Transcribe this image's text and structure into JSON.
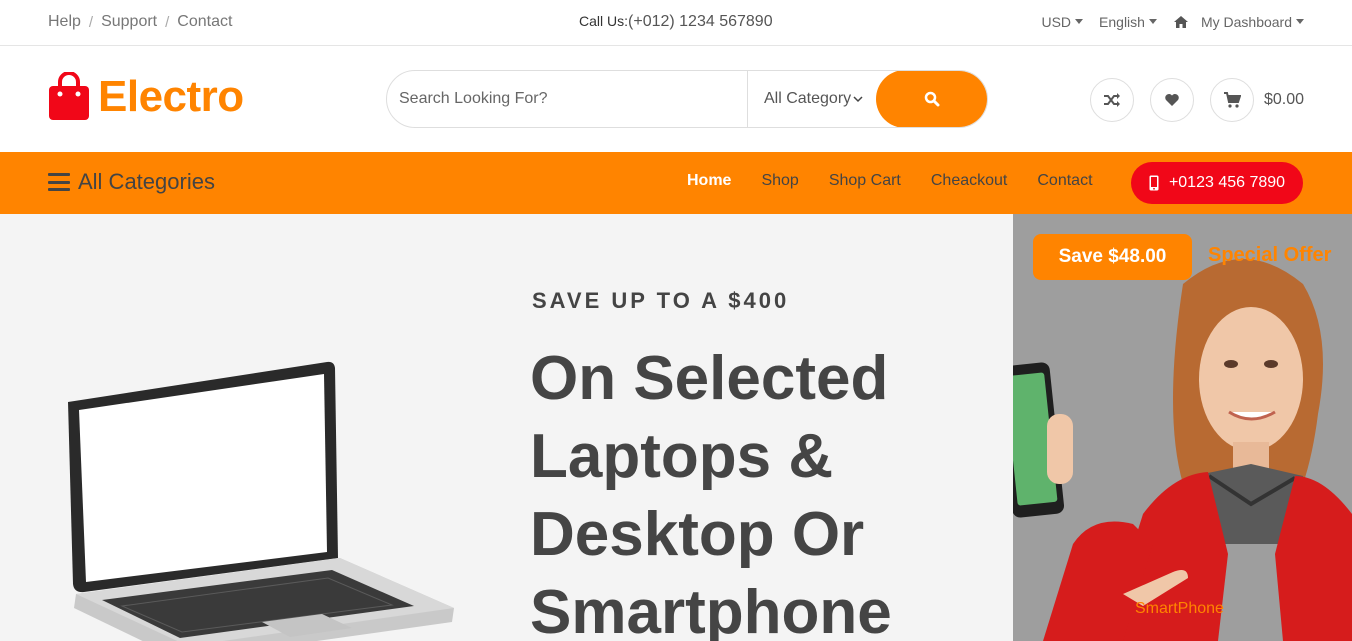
{
  "topbar": {
    "links": [
      "Help",
      "Support",
      "Contact"
    ],
    "separator": "/",
    "call_label": "Call Us:",
    "call_number": "(+012) 1234 567890",
    "currency": "USD",
    "language": "English",
    "dashboard": "My Dashboard"
  },
  "header": {
    "logo": "Electro",
    "search_placeholder": "Search Looking For?",
    "category": "All Category",
    "cart_total": "$0.00"
  },
  "nav": {
    "all_categories": "All Categories",
    "menu": [
      "Home",
      "Shop",
      "Shop Cart",
      "Cheackout",
      "Contact"
    ],
    "active": "Home",
    "phone": "+0123 456 7890"
  },
  "hero": {
    "kicker": "SAVE UP TO A $400",
    "headline": "On Selected Laptops & Desktop Or Smartphone"
  },
  "offer": {
    "save": "Save $48.00",
    "special": "Special Offer",
    "category": "SmartPhone"
  },
  "colors": {
    "accent": "#ff8400",
    "phone_button": "#f10718",
    "hero_bg": "#f4f4f4"
  }
}
